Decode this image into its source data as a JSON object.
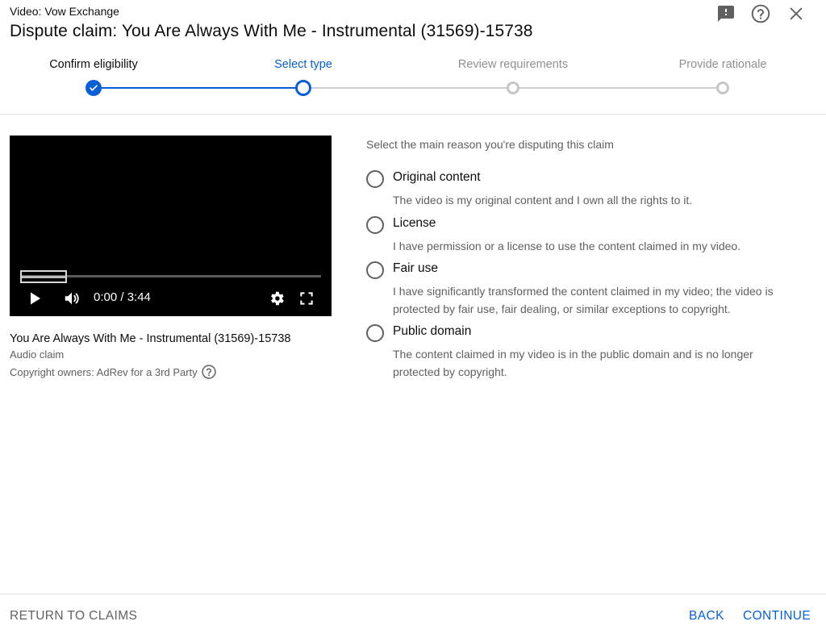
{
  "header": {
    "video_label": "Video: Vow Exchange",
    "title": "Dispute claim: You Are Always With Me - Instrumental (31569)-15738",
    "icons": [
      "feedback-icon",
      "help-icon",
      "close-icon"
    ]
  },
  "stepper": {
    "steps": [
      {
        "label": "Confirm eligibility",
        "state": "done"
      },
      {
        "label": "Select type",
        "state": "active"
      },
      {
        "label": "Review requirements",
        "state": "todo"
      },
      {
        "label": "Provide rationale",
        "state": "todo"
      }
    ]
  },
  "player": {
    "time": "0:00 / 3:44",
    "controls": [
      "play-icon",
      "volume-icon",
      "settings-icon",
      "fullscreen-icon"
    ]
  },
  "claim": {
    "title": "You Are Always With Me - Instrumental (31569)-15738",
    "type": "Audio claim",
    "owners": "Copyright owners: AdRev for a 3rd Party"
  },
  "form": {
    "prompt": "Select the main reason you're disputing this claim",
    "options": [
      {
        "label": "Original content",
        "description": "The video is my original content and I own all the rights to it."
      },
      {
        "label": "License",
        "description": "I have permission or a license to use the content claimed in my video."
      },
      {
        "label": "Fair use",
        "description": "I have significantly transformed the content claimed in my video; the video is protected by fair use, fair dealing, or similar exceptions to copyright."
      },
      {
        "label": "Public domain",
        "description": "The content claimed in my video is in the public domain and is no longer protected by copyright."
      }
    ]
  },
  "footer": {
    "return_label": "RETURN TO CLAIMS",
    "back_label": "BACK",
    "continue_label": "CONTINUE"
  },
  "colors": {
    "accent": "#065fd4",
    "muted_text": "#606060",
    "todo_step": "#c6c6c6"
  }
}
